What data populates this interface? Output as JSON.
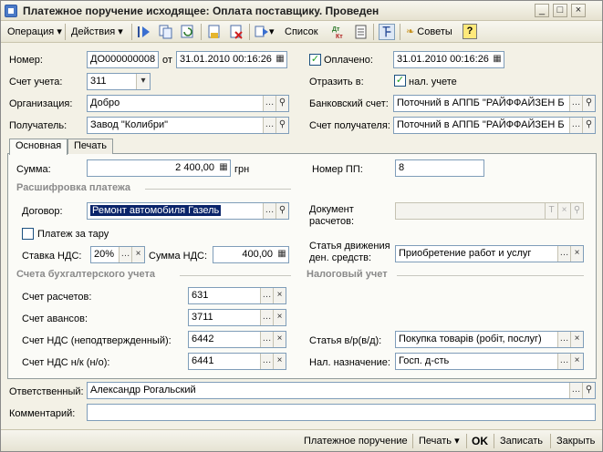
{
  "window": {
    "title": "Платежное поручение исходящее: Оплата поставщику. Проведен",
    "btn_min": "_",
    "btn_max": "□",
    "btn_close": "×"
  },
  "toolbar": {
    "operation": "Операция",
    "actions": "Действия",
    "list": "Список",
    "tips": "Советы",
    "help": "?",
    "dt_kt": "Дт Кт"
  },
  "header": {
    "number_label": "Номер:",
    "number_value": "ДО000000008",
    "from_label": "от",
    "date_value": "31.01.2010 00:16:26",
    "paid_label": "Оплачено:",
    "paid_date": "31.01.2010 00:16:26",
    "account_label": "Счет учета:",
    "account_value": "311",
    "reflect_label": "Отразить в:",
    "tax_acc_label": "нал. учете",
    "org_label": "Организация:",
    "org_value": "Добро",
    "bank_label": "Банковский счет:",
    "bank_value": "Поточний в АППБ \"РАЙФФАЙЗЕН Б",
    "recipient_label": "Получатель:",
    "recipient_value": "Завод \"Колибри\"",
    "rec_account_label": "Счет получателя:",
    "rec_account_value": "Поточний в АППБ \"РАЙФФАЙЗЕН Б"
  },
  "tabs": [
    "Основная",
    "Печать"
  ],
  "main": {
    "sum_label": "Сумма:",
    "sum_value": "2 400,00",
    "currency": "грн",
    "pp_label": "Номер ПП:",
    "pp_value": "8",
    "section_payment": "Расшифровка платежа",
    "contract_label": "Договор:",
    "contract_value": "Ремонт автомобиля Газель",
    "doc_label_1": "Документ",
    "doc_label_2": "расчетов:",
    "tare_label": "Платеж за тару",
    "vat_rate_label": "Ставка НДС:",
    "vat_rate_value": "20%",
    "vat_sum_label": "Сумма НДС:",
    "vat_sum_value": "400,00",
    "cashflow_label_1": "Статья движения",
    "cashflow_label_2": "ден. средств:",
    "cashflow_value": "Приобретение работ и услуг",
    "section_accounts": "Счета бухгалтерского учета",
    "section_tax": "Налоговый учет",
    "calc_acc_label": "Счет расчетов:",
    "calc_acc_value": "631",
    "adv_acc_label": "Счет авансов:",
    "adv_acc_value": "3711",
    "vat_unconf_label": "Счет НДС (неподтвержденный):",
    "vat_unconf_value": "6442",
    "vat_nk_label": "Счет НДС н/к (н/о):",
    "vat_nk_value": "6441",
    "article_label": "Статья в/р(в/д):",
    "article_value": "Покупка товарів (робіт, послуг)",
    "tax_purpose_label": "Нал. назначение:",
    "tax_purpose_value": "Госп. д-сть"
  },
  "bottom": {
    "responsible_label": "Ответственный:",
    "responsible_value": "Александр Рогальский",
    "comment_label": "Комментарий:",
    "comment_value": ""
  },
  "footer": {
    "payment_order": "Платежное поручение",
    "print": "Печать",
    "ok": "OK",
    "save": "Записать",
    "close": "Закрыть"
  },
  "colors": {
    "selection": "#0a246a",
    "check_mark": "#21a121"
  }
}
